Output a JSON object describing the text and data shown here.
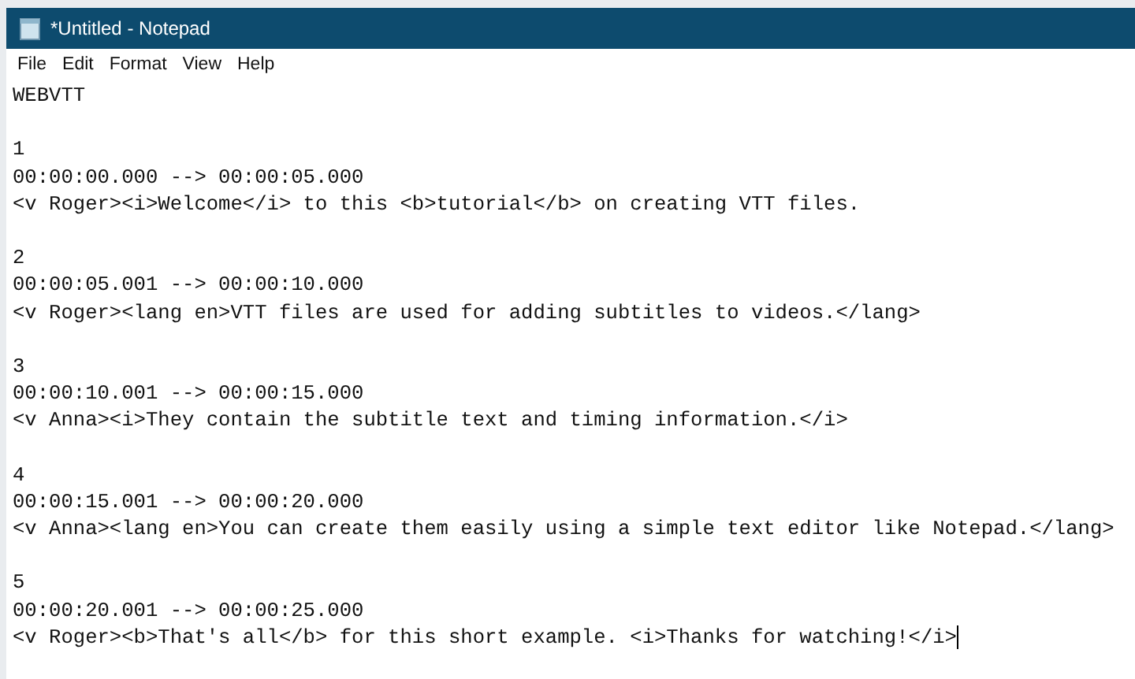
{
  "window": {
    "title": "*Untitled - Notepad"
  },
  "menu": [
    "File",
    "Edit",
    "Format",
    "View",
    "Help"
  ],
  "document": {
    "header": "WEBVTT",
    "cues": [
      {
        "id": "1",
        "timing": "00:00:00.000 --> 00:00:05.000",
        "text": "<v Roger><i>Welcome</i> to this <b>tutorial</b> on creating VTT files."
      },
      {
        "id": "2",
        "timing": "00:00:05.001 --> 00:00:10.000",
        "text": "<v Roger><lang en>VTT files are used for adding subtitles to videos.</lang>"
      },
      {
        "id": "3",
        "timing": "00:00:10.001 --> 00:00:15.000",
        "text": "<v Anna><i>They contain the subtitle text and timing information.</i>"
      },
      {
        "id": "4",
        "timing": "00:00:15.001 --> 00:00:20.000",
        "text": "<v Anna><lang en>You can create them easily using a simple text editor like Notepad.</lang>"
      },
      {
        "id": "5",
        "timing": "00:00:20.001 --> 00:00:25.000",
        "text": "<v Roger><b>That's all</b> for this short example. <i>Thanks for watching!</i>"
      }
    ]
  }
}
